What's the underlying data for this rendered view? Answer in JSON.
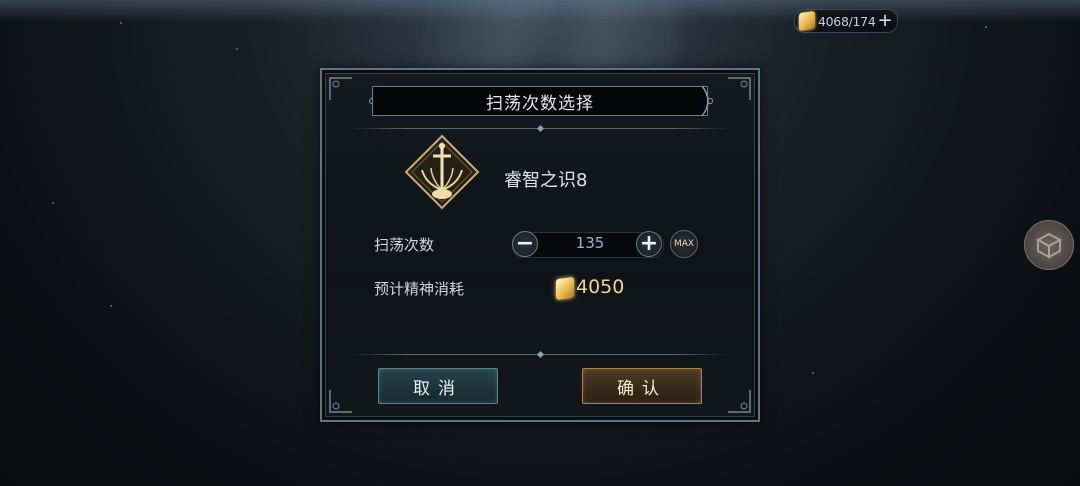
{
  "currency": {
    "icon": "gold-crystal-icon",
    "value": "4068/174",
    "plus": "+"
  },
  "side_button": {
    "icon": "cube-icon"
  },
  "dialog": {
    "title": "扫荡次数选择",
    "item": {
      "icon": "sword-emblem-icon",
      "name": "睿智之识8"
    },
    "sweep_count": {
      "label": "扫荡次数",
      "minus": "−",
      "value": "135",
      "plus": "+",
      "max": "MAX"
    },
    "cost": {
      "label": "预计精神消耗",
      "icon": "gold-crystal-icon",
      "value": "4050"
    },
    "buttons": {
      "cancel": "取消",
      "confirm": "确认"
    }
  },
  "colors": {
    "count_value": "#8cb8e2",
    "cost_value": "#f2d28c",
    "frame": "#5e7384"
  }
}
